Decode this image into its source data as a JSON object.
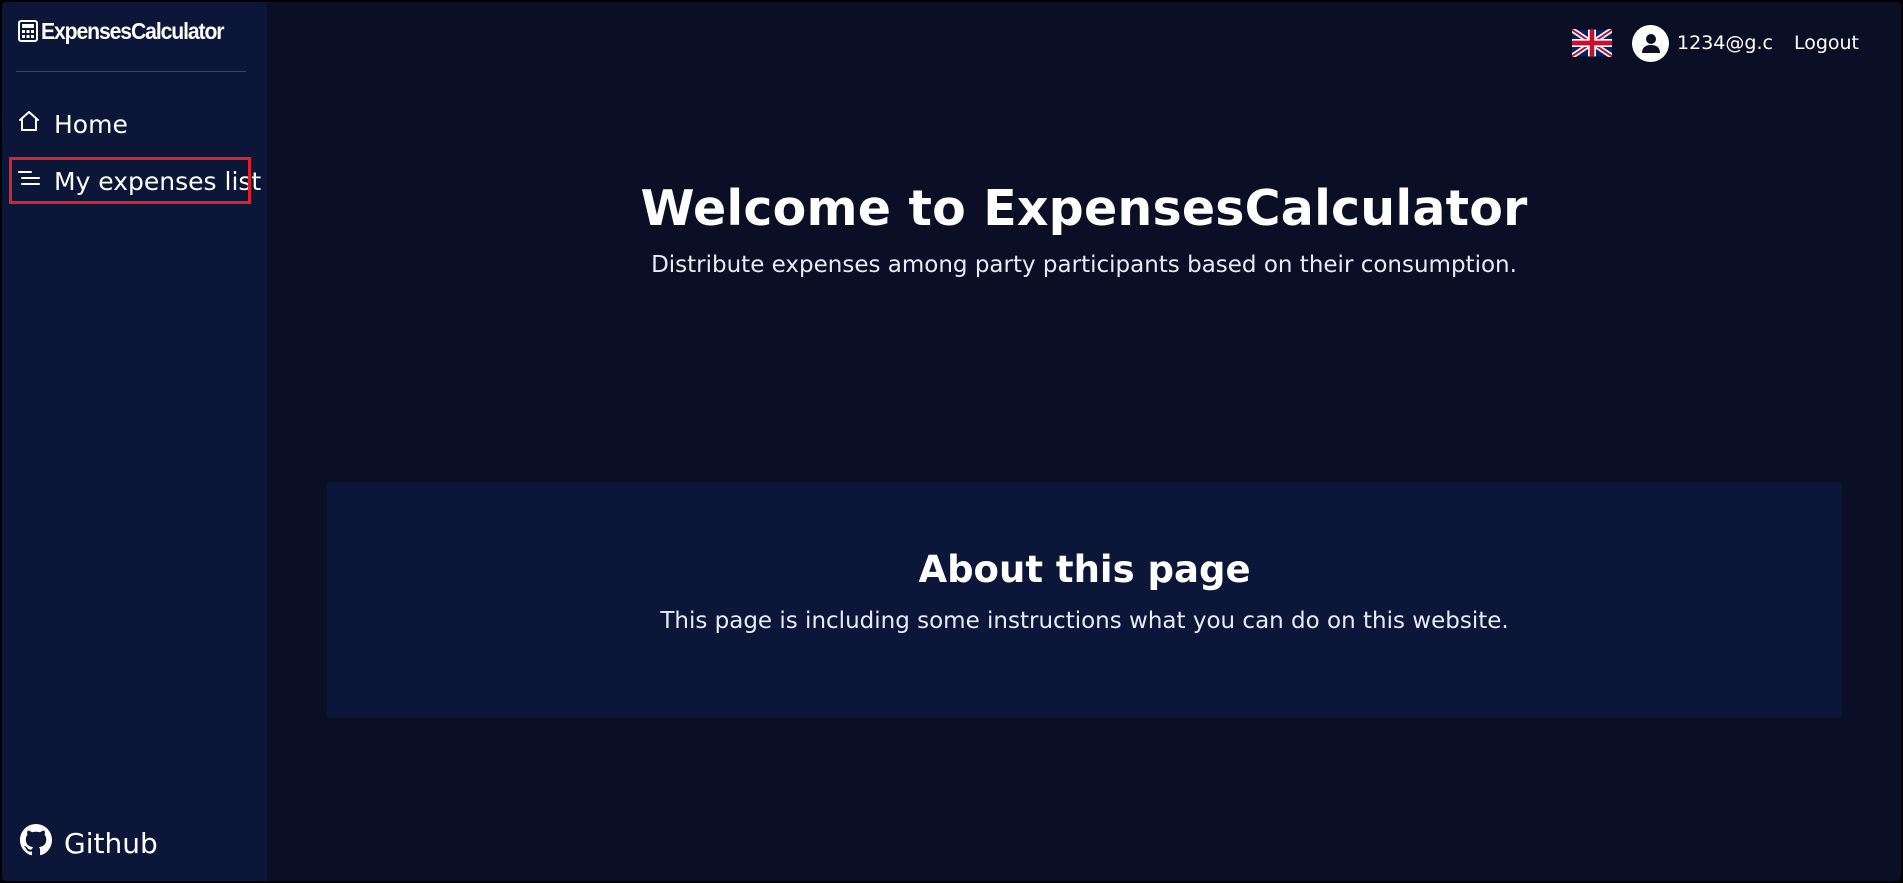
{
  "brand": {
    "name": "ExpensesCalculator",
    "icon": "calculator-icon"
  },
  "sidebar": {
    "items": [
      {
        "label": "Home",
        "icon": "home-icon"
      },
      {
        "label": "My expenses list",
        "icon": "list-icon",
        "highlighted": true
      }
    ],
    "footer": {
      "label": "Github",
      "icon": "github-icon"
    }
  },
  "header": {
    "language_icon": "uk-flag-icon",
    "user_icon": "user-avatar-icon",
    "user_email": "1234@g.c",
    "logout_label": "Logout"
  },
  "main": {
    "title": "Welcome to ExpensesCalculator",
    "subtitle": "Distribute expenses among party participants based on their consumption."
  },
  "about": {
    "title": "About this page",
    "text": "This page is including some instructions what you can do on this website."
  },
  "colors": {
    "background": "#0a0f26",
    "sidebar": "#0c1638",
    "card": "#0c1638",
    "highlight": "#e0202b",
    "text": "#ffffff"
  }
}
